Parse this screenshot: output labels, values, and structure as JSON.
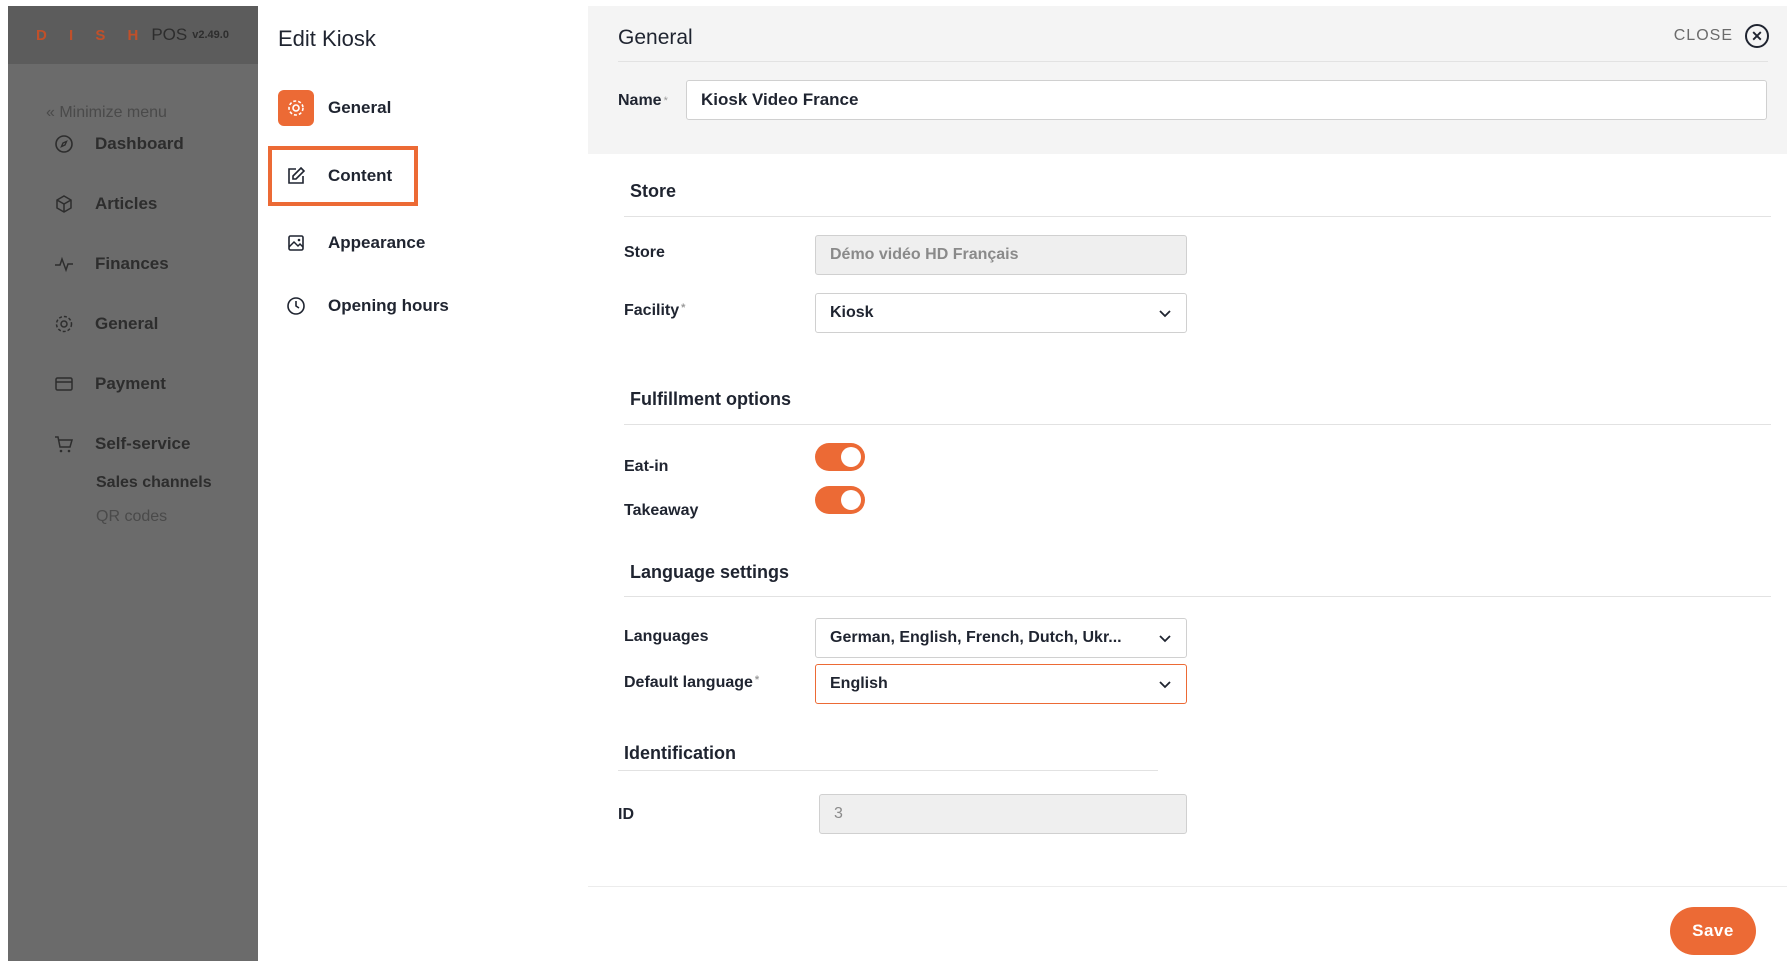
{
  "app": {
    "brand": "D I S H",
    "product": "POS",
    "version": "v2.49.0"
  },
  "sidebar": {
    "minimize_label": "« Minimize menu",
    "items": [
      {
        "label": "Dashboard",
        "icon": "compass-icon"
      },
      {
        "label": "Articles",
        "icon": "box-icon"
      },
      {
        "label": "Finances",
        "icon": "pulse-icon"
      },
      {
        "label": "General",
        "icon": "gear-icon"
      },
      {
        "label": "Payment",
        "icon": "card-icon"
      },
      {
        "label": "Self-service",
        "icon": "cart-icon"
      }
    ],
    "subitems": [
      {
        "label": "Sales channels"
      },
      {
        "label": "QR codes"
      }
    ]
  },
  "edit_panel": {
    "title": "Edit Kiosk",
    "items": [
      {
        "label": "General",
        "icon": "gear-icon",
        "active": true
      },
      {
        "label": "Content",
        "icon": "edit-icon",
        "highlighted": true
      },
      {
        "label": "Appearance",
        "icon": "image-icon"
      },
      {
        "label": "Opening hours",
        "icon": "clock-icon"
      }
    ]
  },
  "main": {
    "title": "General",
    "close_label": "CLOSE",
    "name_label": "Name",
    "name_required": "*",
    "name_value": "Kiosk Video France",
    "store_section": {
      "heading": "Store",
      "store_label": "Store",
      "store_value": "Démo vidéo HD Français",
      "facility_label": "Facility",
      "facility_required": "*",
      "facility_value": "Kiosk"
    },
    "fulfillment_section": {
      "heading": "Fulfillment options",
      "eat_in_label": "Eat-in",
      "eat_in_enabled": true,
      "takeaway_label": "Takeaway",
      "takeaway_enabled": true
    },
    "language_section": {
      "heading": "Language settings",
      "languages_label": "Languages",
      "languages_value": "German, English, French, Dutch, Ukr...",
      "default_label": "Default language",
      "default_required": "*",
      "default_value": "English"
    },
    "identification_section": {
      "heading": "Identification",
      "id_label": "ID",
      "id_value": "3"
    },
    "save_label": "Save"
  },
  "colors": {
    "accent": "#ec6a35",
    "sidebar_bg": "#6b6b6b",
    "header_bg": "#f4f4f4"
  }
}
